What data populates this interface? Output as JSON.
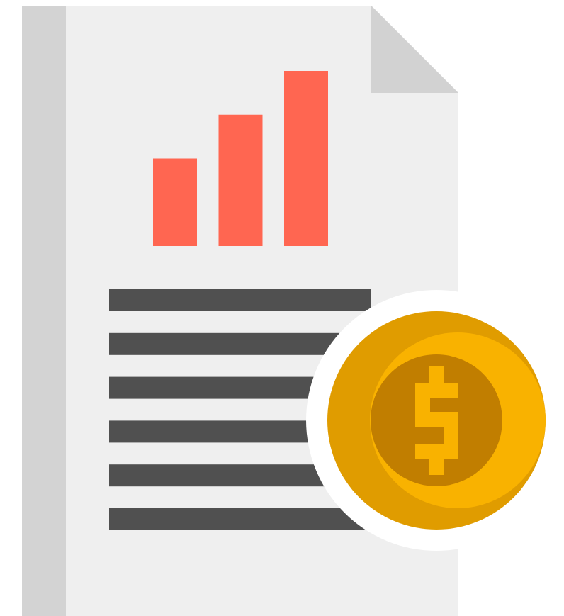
{
  "illustration": {
    "icon": "financial-report-with-dollar-coin-icon",
    "colors": {
      "background": "#ffffff",
      "page": "#efefef",
      "page_spine": "#d3d3d3",
      "page_fold": "#d2d2d2",
      "bars": "#ff6651",
      "text_lines": "#505050",
      "coin_halo": "#ffffff",
      "coin_rim": "#e09c00",
      "coin_face": "#f9b200",
      "coin_inner": "#c17e00",
      "dollar_sign": "#f9b200"
    },
    "bar_chart": {
      "type": "bar",
      "values": [
        2,
        3,
        4
      ]
    },
    "text_line_count": 6
  }
}
